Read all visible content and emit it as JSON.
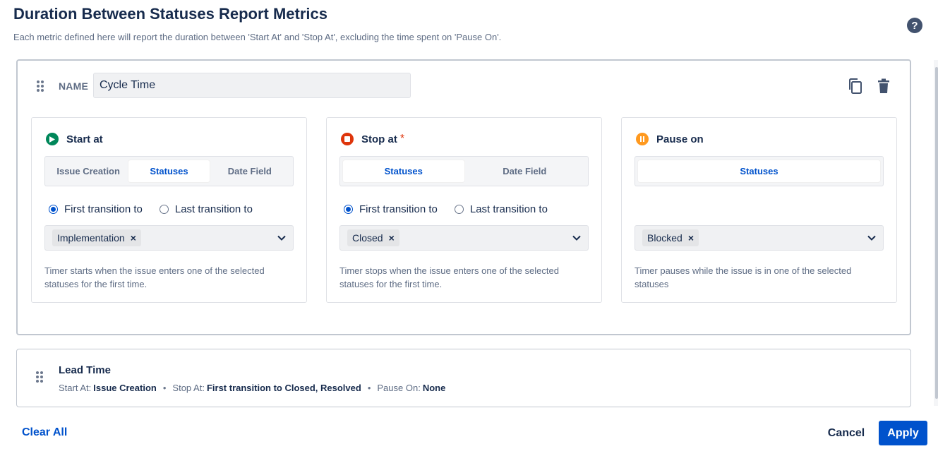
{
  "header": {
    "title": "Duration Between Statuses Report Metrics",
    "subtitle": "Each metric defined here will report the duration between 'Start At' and 'Stop At', excluding the time spent on 'Pause On'.",
    "help_glyph": "?"
  },
  "metric": {
    "name_label": "NAME",
    "name_value": "Cycle Time",
    "start": {
      "title": "Start at",
      "tabs": [
        "Issue Creation",
        "Statuses",
        "Date Field"
      ],
      "active_tab": "Statuses",
      "radio_first": "First transition to",
      "radio_last": "Last transition to",
      "selected_radio": "first",
      "chip": "Implementation",
      "hint": "Timer starts when the issue enters one of the selected statuses for the first time."
    },
    "stop": {
      "title": "Stop at",
      "required_mark": "*",
      "tabs": [
        "Statuses",
        "Date Field"
      ],
      "active_tab": "Statuses",
      "radio_first": "First transition to",
      "radio_last": "Last transition to",
      "selected_radio": "first",
      "chip": "Closed",
      "hint": "Timer stops when the issue enters one of the selected statuses for the first time."
    },
    "pause": {
      "title": "Pause on",
      "tabs": [
        "Statuses"
      ],
      "active_tab": "Statuses",
      "chip": "Blocked",
      "hint": "Timer pauses while the issue is in one of the selected statuses"
    },
    "chip_remove": "×"
  },
  "lead": {
    "title": "Lead Time",
    "start_label": "Start At:",
    "start_value": "Issue Creation",
    "stop_label": "Stop At:",
    "stop_value": "First transition to Closed, Resolved",
    "pause_label": "Pause On:",
    "pause_value": "None",
    "separator": "•"
  },
  "footer": {
    "clear_all": "Clear All",
    "cancel": "Cancel",
    "apply": "Apply"
  },
  "icons": {
    "start": "play-circle-icon",
    "stop": "stop-circle-icon",
    "pause": "pause-circle-icon",
    "copy": "copy-icon",
    "delete": "trash-icon"
  },
  "colors": {
    "primary": "#0052cc",
    "start_green": "#00875a",
    "stop_red": "#de350b",
    "pause_orange": "#ff991f",
    "text": "#172b4d",
    "muted": "#5e6c84"
  }
}
